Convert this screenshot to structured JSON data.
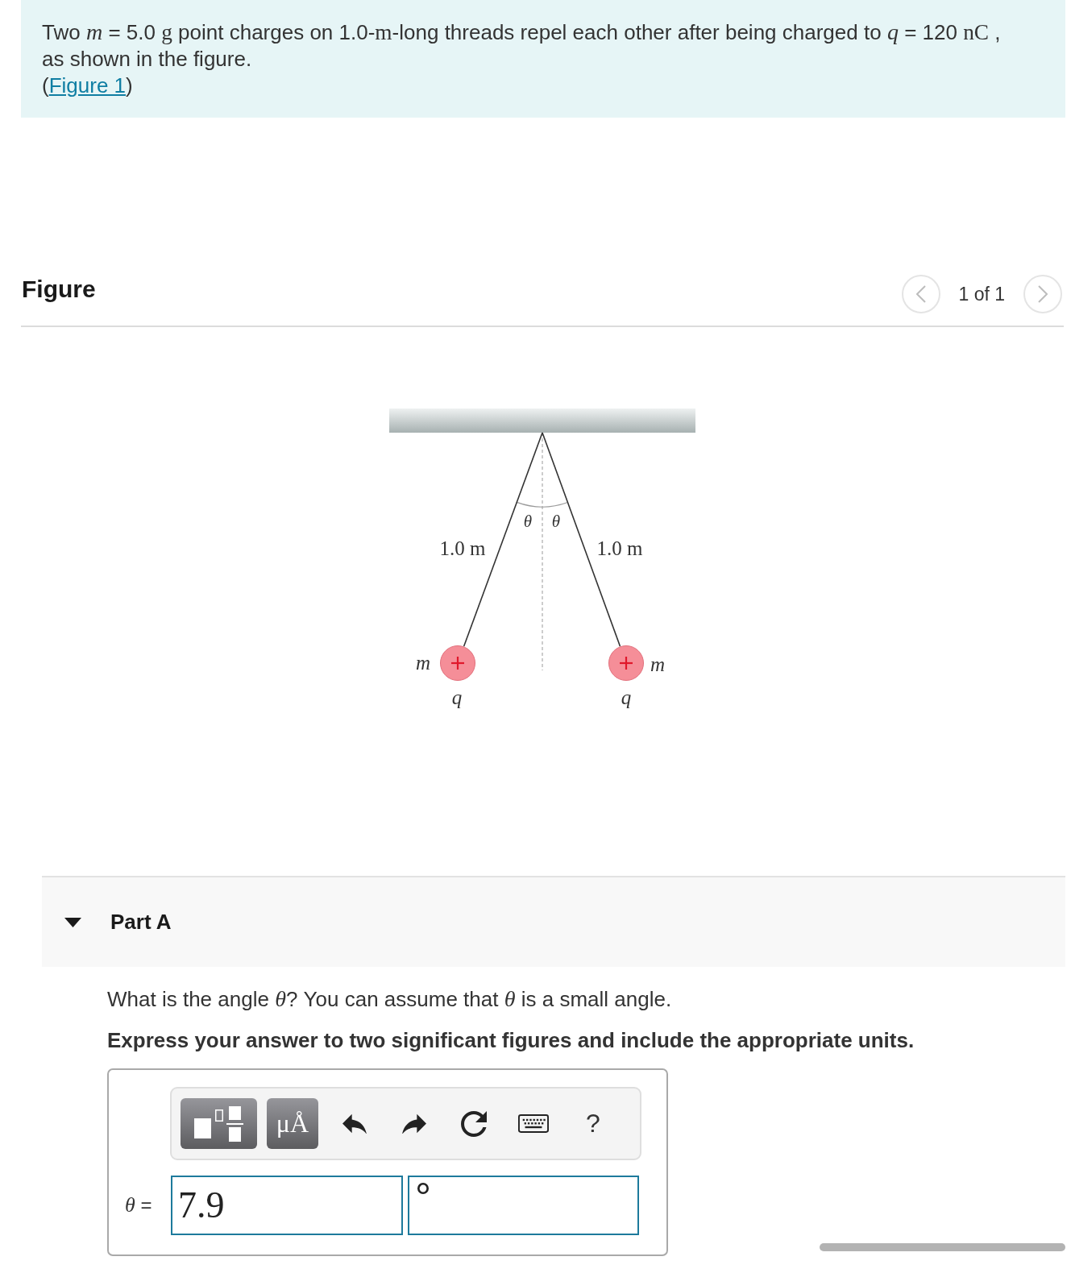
{
  "intro": {
    "segments": [
      {
        "kind": "text",
        "text": "Two "
      },
      {
        "kind": "var",
        "text": "m"
      },
      {
        "kind": "text",
        "text": " = 5.0 "
      },
      {
        "kind": "unit",
        "text": "g"
      },
      {
        "kind": "text",
        "text": " point charges on 1.0-"
      },
      {
        "kind": "unit",
        "text": "m"
      },
      {
        "kind": "text",
        "text": "-long threads repel each other after being charged to "
      },
      {
        "kind": "var",
        "text": "q"
      },
      {
        "kind": "text",
        "text": " = 120 "
      },
      {
        "kind": "unit",
        "text": "nC"
      },
      {
        "kind": "text",
        "text": " , as shown in the figure."
      }
    ],
    "figure_ref": {
      "open": "(",
      "link": "Figure 1",
      "close": ")"
    }
  },
  "figure": {
    "title": "Figure",
    "pager": {
      "previous": {
        "disabled": true
      },
      "label": "1 of 1",
      "next": {
        "disabled": true
      }
    },
    "diagram": {
      "sides": [
        {
          "angle": "θ",
          "length": "1.0 m",
          "mass": "m",
          "charge": "q"
        },
        {
          "angle": "θ",
          "length": "1.0 m",
          "mass": "m",
          "charge": "q"
        }
      ]
    }
  },
  "part": {
    "title": "Part A",
    "expanded": true,
    "question": [
      {
        "kind": "text",
        "text": "What is the angle "
      },
      {
        "kind": "var",
        "text": "θ"
      },
      {
        "kind": "text",
        "text": "? You can assume that "
      },
      {
        "kind": "var",
        "text": "θ"
      },
      {
        "kind": "text",
        "text": " is a small angle."
      }
    ],
    "instruction": "Express your answer to two significant figures and include the appropriate units.",
    "toolbar": {
      "units_label": "μÅ",
      "help_label": "?"
    },
    "answer": {
      "label": [
        {
          "kind": "var",
          "text": "θ"
        },
        {
          "kind": "text",
          "text": " ="
        }
      ],
      "value": "7.9",
      "units": "°"
    }
  }
}
